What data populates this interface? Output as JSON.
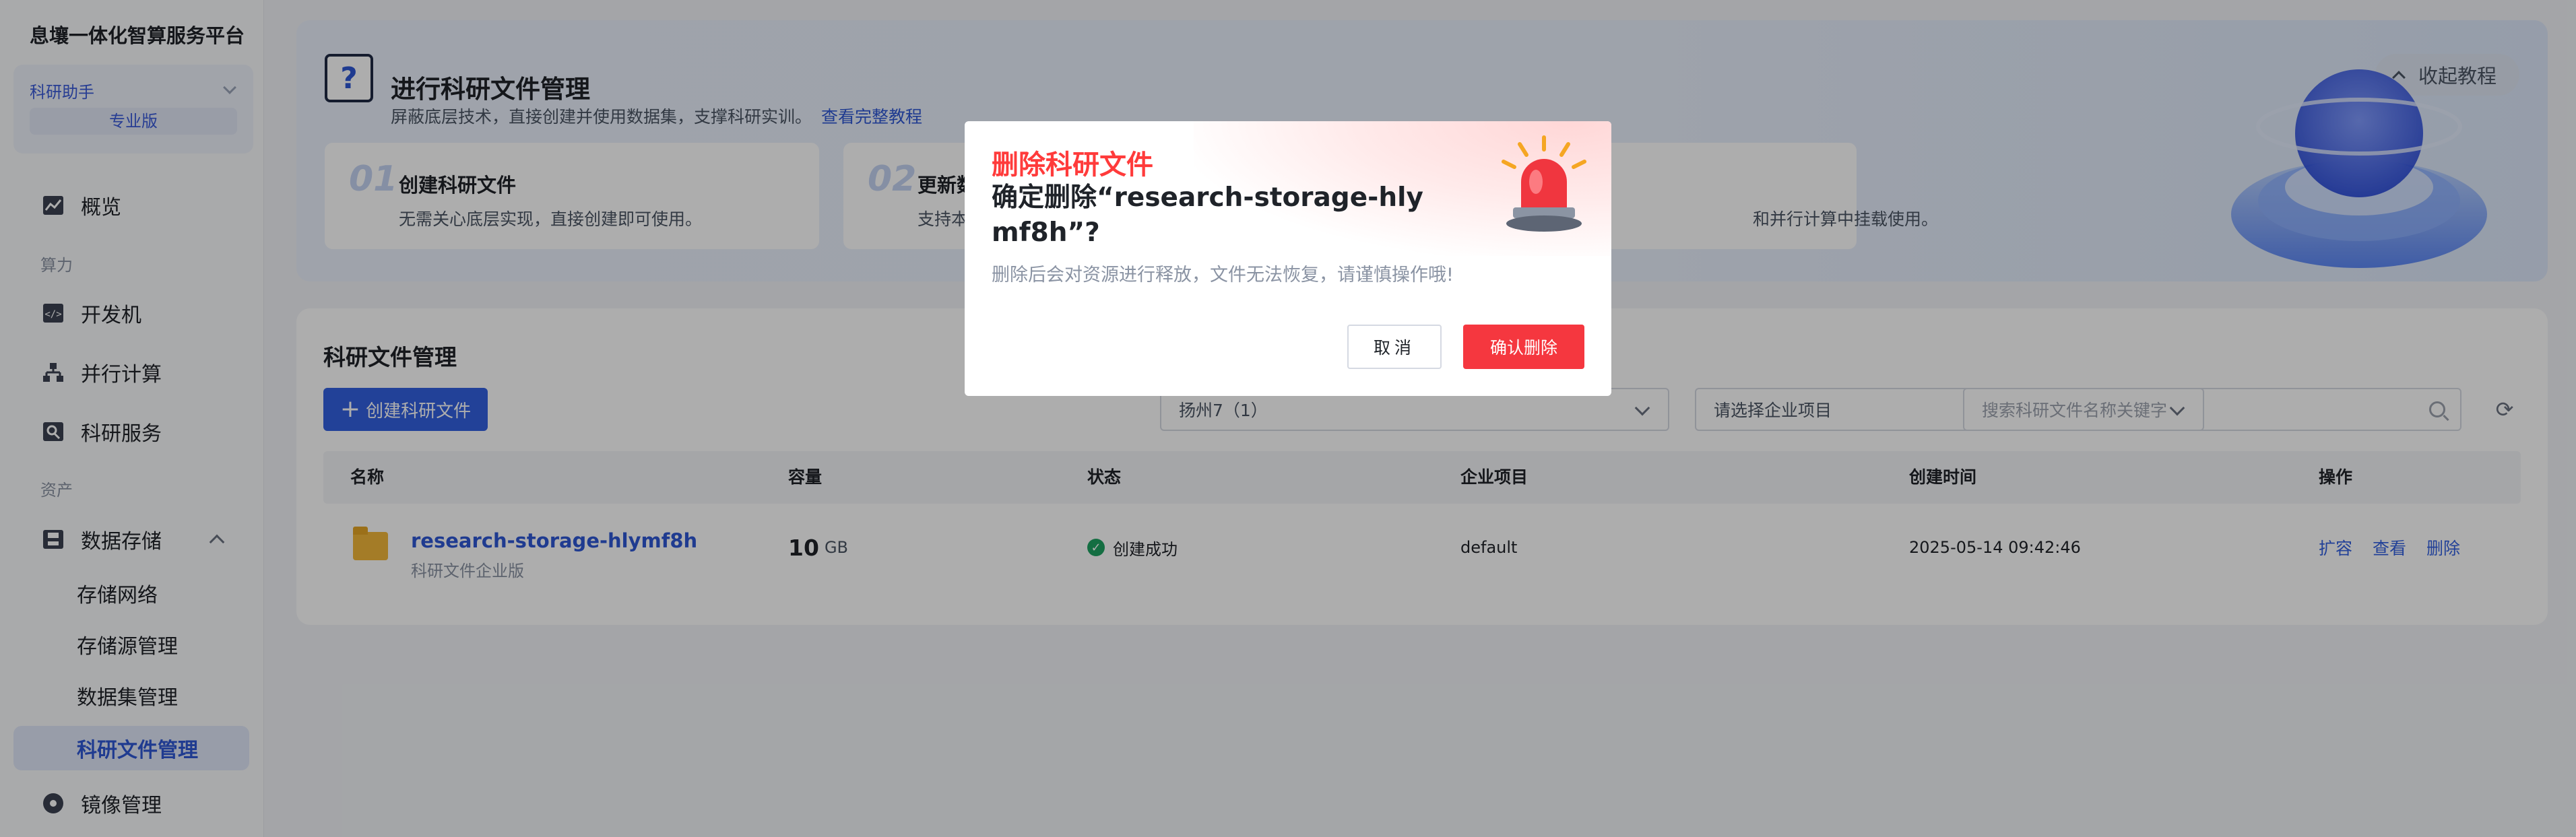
{
  "app": {
    "title": "息壤一体化智算服务平台"
  },
  "sidebar": {
    "assistant": {
      "label": "科研助手",
      "edition": "专业版"
    },
    "items": [
      {
        "label": "概览",
        "icon": "chart-icon"
      },
      {
        "section": "算力"
      },
      {
        "label": "开发机",
        "icon": "code-icon"
      },
      {
        "label": "并行计算",
        "icon": "hierarchy-icon"
      },
      {
        "label": "科研服务",
        "icon": "research-icon"
      },
      {
        "section": "资产"
      },
      {
        "label": "数据存储",
        "icon": "storage-icon"
      },
      {
        "label": "存储网络"
      },
      {
        "label": "存储源管理"
      },
      {
        "label": "数据集管理"
      },
      {
        "label": "科研文件管理",
        "active": true
      },
      {
        "label": "镜像管理",
        "icon": "disc-icon"
      }
    ]
  },
  "banner": {
    "title": "进行科研文件管理",
    "desc": "屏蔽底层技术，直接创建并使用数据集，支撑科研实训。",
    "link": "查看完整教程",
    "collapse": "收起教程",
    "steps": [
      {
        "num": "01",
        "title": "创建科研文件",
        "desc": "无需关心底层实现，直接创建即可使用。"
      },
      {
        "num": "02",
        "title": "更新数",
        "desc": "支持本"
      },
      {
        "num": "",
        "title": "",
        "desc": "和并行计算中挂载使用。"
      }
    ]
  },
  "panel": {
    "title": "科研文件管理",
    "create": "创建科研文件",
    "region": "扬州7（1）",
    "project_placeholder": "请选择企业项目",
    "search_placeholder": "搜索科研文件名称关键字",
    "columns": [
      "名称",
      "容量",
      "状态",
      "企业项目",
      "创建时间",
      "操作"
    ],
    "rows": [
      {
        "name": "research-storage-hlymf8h",
        "subtitle": "科研文件企业版",
        "capacity": "10",
        "unit": "GB",
        "status": "创建成功",
        "project": "default",
        "created": "2025-05-14 09:42:46",
        "actions": [
          "扩容",
          "查看",
          "删除"
        ]
      }
    ]
  },
  "modal": {
    "kicker": "删除科研文件",
    "title": "确定删除“research-storage-hlymf8h”?",
    "desc": "删除后会对资源进行释放，文件无法恢复，请谨慎操作哦!",
    "cancel": "取消",
    "confirm": "确认删除"
  },
  "colors": {
    "primary": "#3360e0",
    "danger": "#f5373f",
    "success": "#1ea362"
  }
}
